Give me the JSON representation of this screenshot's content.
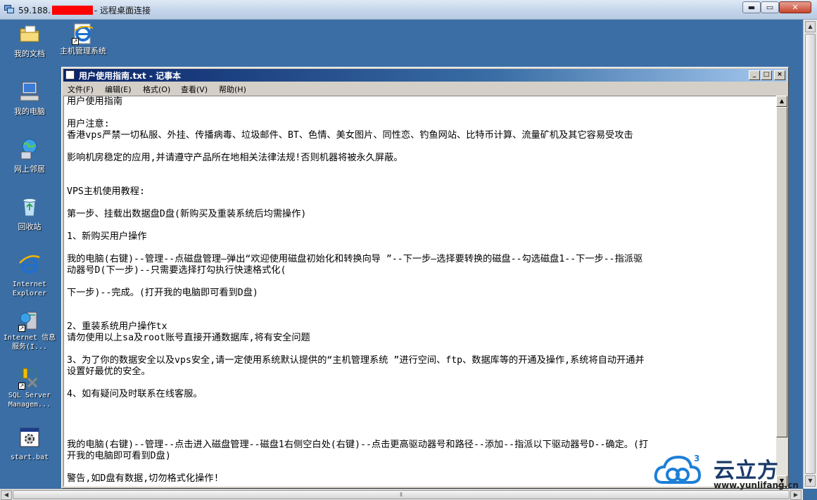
{
  "rdp": {
    "title_prefix": "59.188.",
    "title_suffix": "- 远程桌面连接",
    "min_glyph": "▬",
    "max_glyph": "▭",
    "close_glyph": "✕"
  },
  "desktop_icons": [
    {
      "name": "my-documents",
      "label": "我的文档",
      "icon": "folder-icon"
    },
    {
      "name": "host-management",
      "label": "主机管理系统",
      "icon": "ie-icon"
    },
    {
      "name": "my-computer",
      "label": "我的电脑",
      "icon": "computer-icon"
    },
    {
      "name": "network-places",
      "label": "网上邻居",
      "icon": "network-icon"
    },
    {
      "name": "recycle-bin",
      "label": "回收站",
      "icon": "recycle-bin-icon"
    },
    {
      "name": "internet-explorer",
      "label": "Internet Explorer",
      "icon": "ie-icon"
    },
    {
      "name": "iis",
      "label": "Internet 信息服务(I...",
      "icon": "iis-icon"
    },
    {
      "name": "sql-server",
      "label": "SQL Server Managem...",
      "icon": "sql-server-icon"
    },
    {
      "name": "start-bat",
      "label": "start.bat",
      "icon": "batch-file-icon"
    }
  ],
  "notepad": {
    "title": "用户使用指南.txt - 记事本",
    "menu": [
      "文件(F)",
      "编辑(E)",
      "格式(O)",
      "查看(V)",
      "帮助(H)"
    ],
    "lines": [
      "用户使用指南",
      "",
      "用户注意:",
      "香港vps严禁一切私服、外挂、传播病毒、垃圾邮件、BT、色情、美女图片、同性恋、钓鱼网站、比特币计算、流量矿机及其它容易受攻击",
      "",
      "影响机房稳定的应用,并请遵守产品所在地相关法律法规!否则机器将被永久屏蔽。",
      "",
      "",
      "VPS主机使用教程:",
      "",
      "第一步、挂载出数据盘D盘(新购买及重装系统后均需操作)",
      "",
      "1、新购买用户操作",
      "",
      "我的电脑(右键)--管理--点磁盘管理—弹出“欢迎使用磁盘初始化和转换向导 ”--下一步—选择要转换的磁盘--勾选磁盘1--下一步--指派驱",
      "动器号D(下一步)--只需要选择打勾执行快速格式化(",
      "",
      "下一步)--完成。(打开我的电脑即可看到D盘)",
      "",
      "",
      "",
      "2、重装系统用户操作tx",
      "   请勿使用以上sa及root账号直接开通数据库,将有安全问题",
      "",
      "3、为了你的数据安全以及vps安全,请一定使用系统默认提供的“主机管理系统 ”进行空间、ftp、数据库等的开通及操作,系统将自动开通并",
      "设置好最优的安全。",
      "",
      "4、如有疑问及时联系在线客服。",
      "",
      "",
      "",
      "",
      "",
      "我的电脑(右键)--管理--点击进入磁盘管理--磁盘1右侧空白处(右键)--点击更高驱动器号和路径--添加--指派以下驱动器号D--确定。(打",
      "开我的电脑即可看到D盘)",
      "",
      "警告,如D盘有数据,切勿格式化操作!"
    ]
  },
  "watermark": {
    "brand": "云立方",
    "url": "www.yunlifang.cn",
    "badge": "3"
  }
}
